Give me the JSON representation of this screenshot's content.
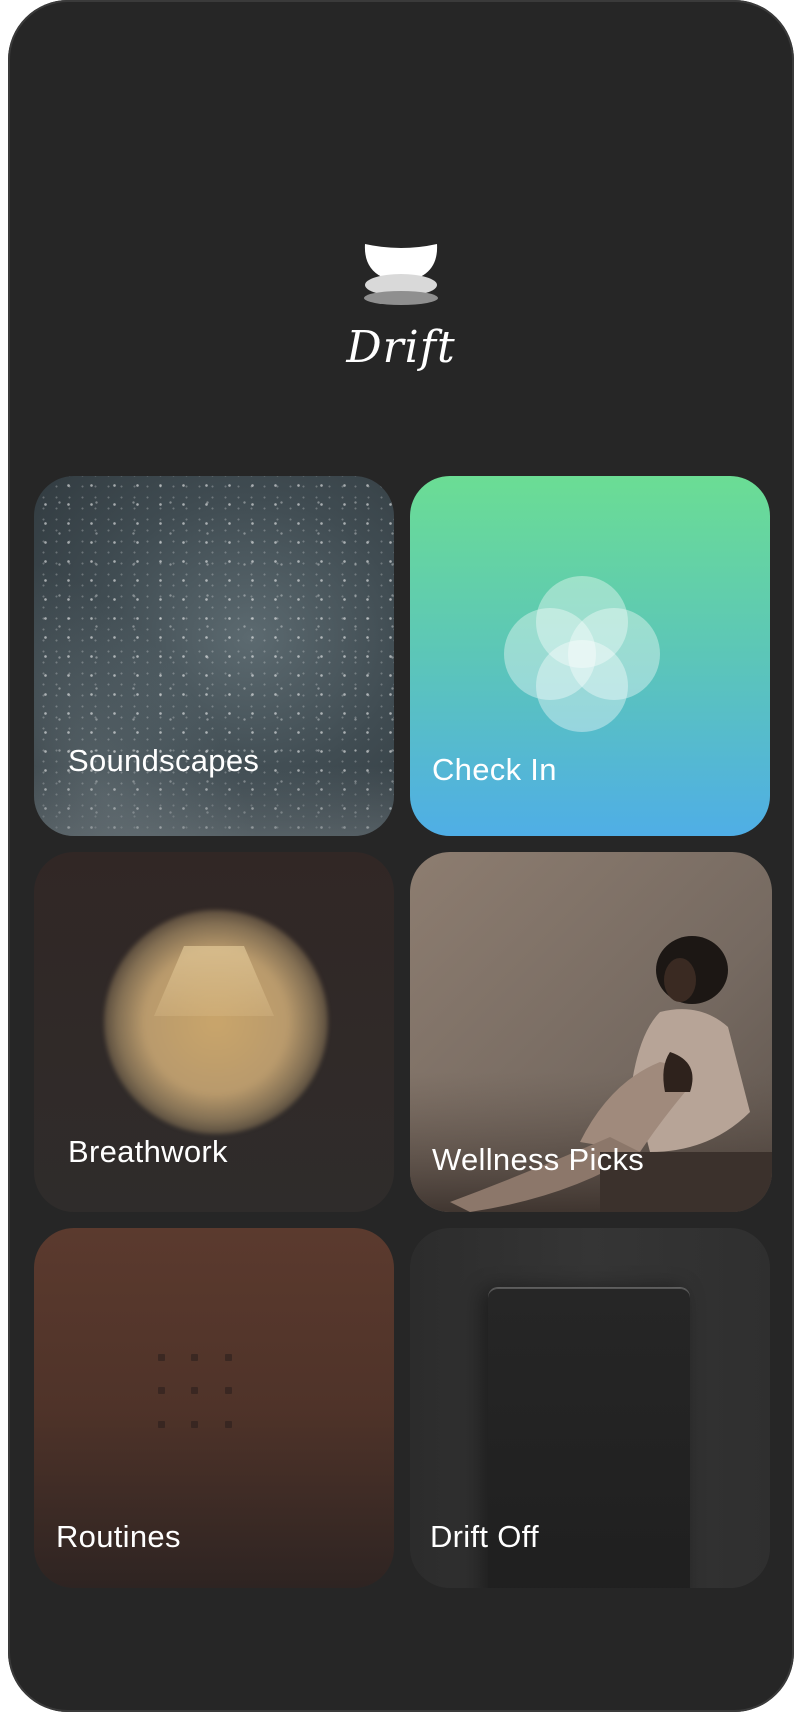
{
  "app": {
    "brand_name": "Drift",
    "logo_icon": "bowl-stones-icon"
  },
  "tiles": [
    {
      "label": "Soundscapes",
      "image": "starry-night-sky"
    },
    {
      "label": "Check In",
      "image": "overlapping-circles",
      "gradient": [
        "#6bdd94",
        "#4faee6"
      ]
    },
    {
      "label": "Breathwork",
      "image": "glowing-orb"
    },
    {
      "label": "Wellness Picks",
      "image": "woman-sitting-photo"
    },
    {
      "label": "Routines",
      "image": "dot-grid"
    },
    {
      "label": "Drift Off",
      "image": "dark-doorway"
    }
  ],
  "colors": {
    "background": "#262626",
    "text": "#ffffff"
  }
}
